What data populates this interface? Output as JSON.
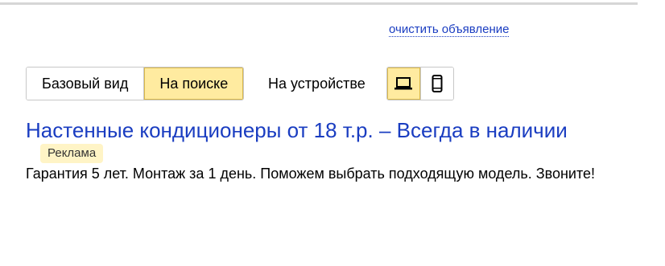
{
  "header": {
    "clear_link": "очистить объявление"
  },
  "view_switch": {
    "tabs": [
      {
        "label": "Базовый вид",
        "active": false
      },
      {
        "label": "На поиске",
        "active": true
      }
    ]
  },
  "device_switch": {
    "label": "На устройстве",
    "options": [
      {
        "icon": "laptop-icon",
        "active": true
      },
      {
        "icon": "phone-icon",
        "active": false
      }
    ]
  },
  "ad": {
    "title": "Настенные кондиционеры от 18 т.р. – Всегда в наличии",
    "badge": "Реклама",
    "text": "Гарантия 5 лет. Монтаж за 1 день. Поможем выбрать подходящую модель. Звоните!"
  },
  "colors": {
    "link": "#1a3dc1",
    "active_tab": "#ffeba0",
    "ad_badge": "#fff4c6"
  }
}
